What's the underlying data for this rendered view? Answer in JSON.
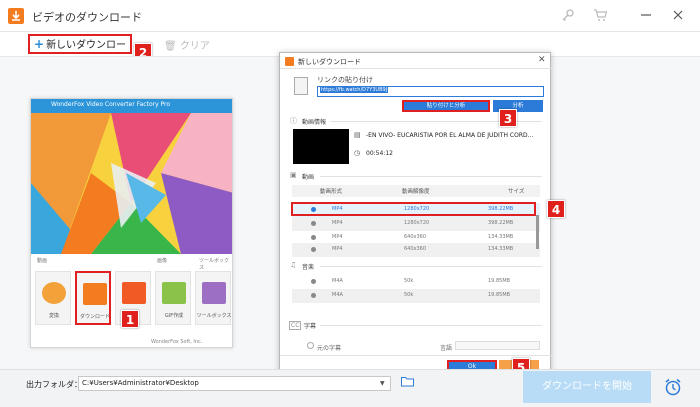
{
  "window": {
    "title": "ビデオのダウンロード"
  },
  "toolbar": {
    "new_download": "新しいダウンロード",
    "clear": "クリア"
  },
  "launcher": {
    "title": "WonderFox Video Converter Factory Pro",
    "sections": {
      "video": "動画",
      "image": "画像",
      "toolbox": "ツールボックス"
    },
    "tiles": [
      {
        "label": "変換",
        "color": "#f3a23a"
      },
      {
        "label": "ダウンロード",
        "color": "#f47c20"
      },
      {
        "label": "録画",
        "color": "#f15a24"
      },
      {
        "label": "GIF作成",
        "color": "#8bc34a"
      },
      {
        "label": "ツールボックス",
        "color": "#9c6fc4"
      }
    ],
    "footer": "WonderFox Soft, Inc."
  },
  "dialog": {
    "title": "新しいダウンロード",
    "paste_label": "リンクの貼り付け",
    "url_value": "https://fb.watch/D7Y3UB9J",
    "paste_analyze_btn": "貼り付けと分析",
    "analyze_btn": "分析",
    "video_info_label": "動画情報",
    "video_title": "-EN VIVO- EUCARISTIA POR EL ALMA DE JUDITH CORD...",
    "video_duration": "00:54:12",
    "video_section": "動画",
    "video_columns": [
      "動画形式",
      "動画解像度",
      "サイズ"
    ],
    "video_rows": [
      {
        "format": "MP4",
        "resolution": "1280x720",
        "size": "398.22MB",
        "selected": true
      },
      {
        "format": "MP4",
        "resolution": "1280x720",
        "size": "398.22MB",
        "selected": false
      },
      {
        "format": "MP4",
        "resolution": "640x360",
        "size": "134.33MB",
        "selected": false
      },
      {
        "format": "MP4",
        "resolution": "640x360",
        "size": "134.33MB",
        "selected": false
      }
    ],
    "audio_section": "音楽",
    "audio_rows": [
      {
        "format": "M4A",
        "bitrate": "50k",
        "size": "19.85MB"
      },
      {
        "format": "M4A",
        "bitrate": "50k",
        "size": "19.85MB"
      }
    ],
    "subtitle_section": "字幕",
    "subtitle_label": "元の字幕",
    "language_label": "言語",
    "ok_btn": "Ok"
  },
  "bottom": {
    "output_label": "出力フォルダ：",
    "output_path": "C:¥Users¥Administrator¥Desktop",
    "start_btn": "ダウンロードを開始"
  },
  "steps": [
    "1",
    "2",
    "3",
    "4",
    "5"
  ],
  "colors": {
    "accent": "#2c7bd8",
    "highlight": "#e02020",
    "brand": "#f47c20"
  }
}
